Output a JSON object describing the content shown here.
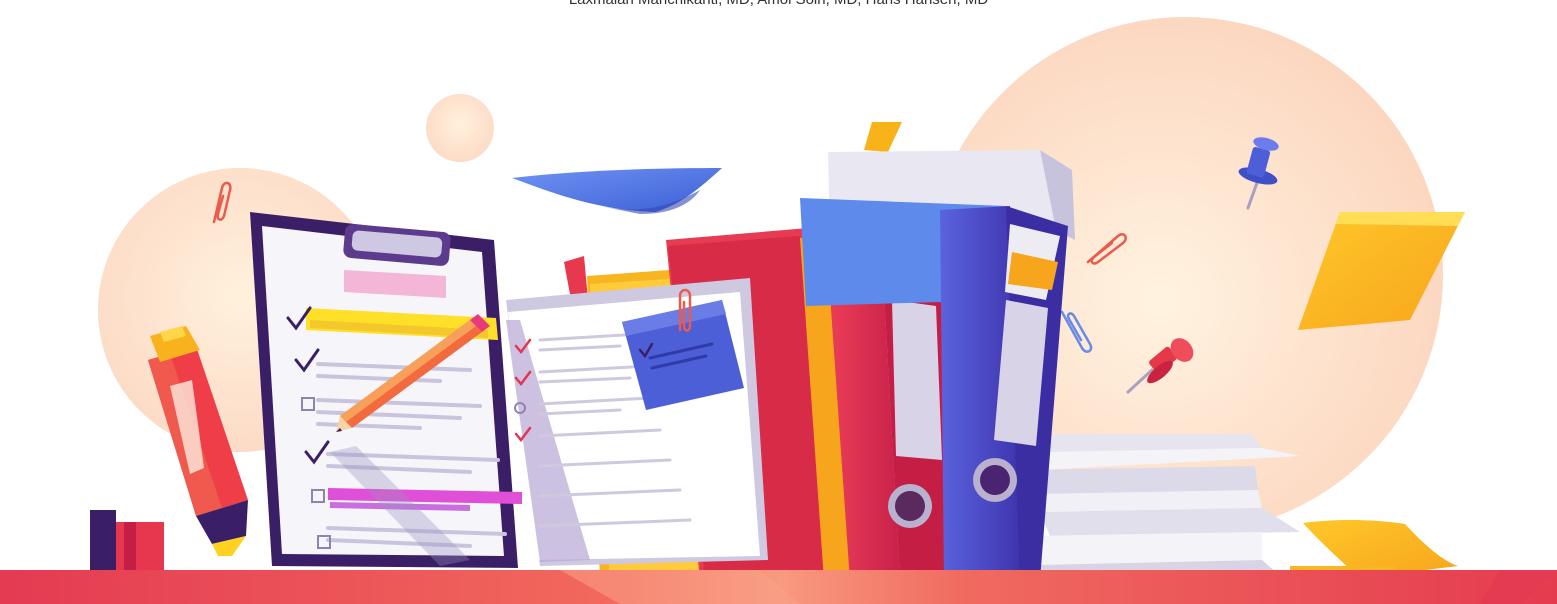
{
  "header": {
    "authors": "Laxmaiah Manchikanti, MD, Amol Soin, MD, Hans Hansen, MD"
  },
  "illustration": {
    "subject": "office-documents-desk",
    "palette": {
      "blush": "#FDE4D2",
      "red": "#E8384E",
      "orange": "#F7B21E",
      "yellow": "#FFD21F",
      "purple": "#3A1F66",
      "indigo": "#4B53C8",
      "blue": "#4C74E0",
      "magenta": "#E04FD8",
      "lavender": "#C9C3DE",
      "paper": "#F4F4F7"
    }
  }
}
